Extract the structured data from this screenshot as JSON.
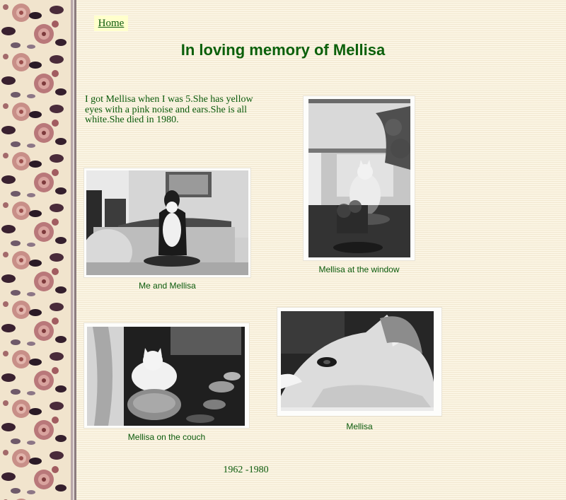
{
  "nav": {
    "home_label": "Home"
  },
  "header": {
    "title": "In loving memory of Mellisa"
  },
  "intro_text": "I got Mellisa when I was 5.She has yellow eyes with a pink noise and ears.She is all white.She died in 1980.",
  "photos": [
    {
      "caption": "Me and Mellisa"
    },
    {
      "caption": "Mellisa at the window"
    },
    {
      "caption": "Mellisa on the couch"
    },
    {
      "caption": "Mellisa"
    }
  ],
  "footer": {
    "years": "1962 -1980"
  },
  "colors": {
    "text": "#0b5a0b",
    "background": "#fbf5e4",
    "home_button": "#ffffcc"
  }
}
